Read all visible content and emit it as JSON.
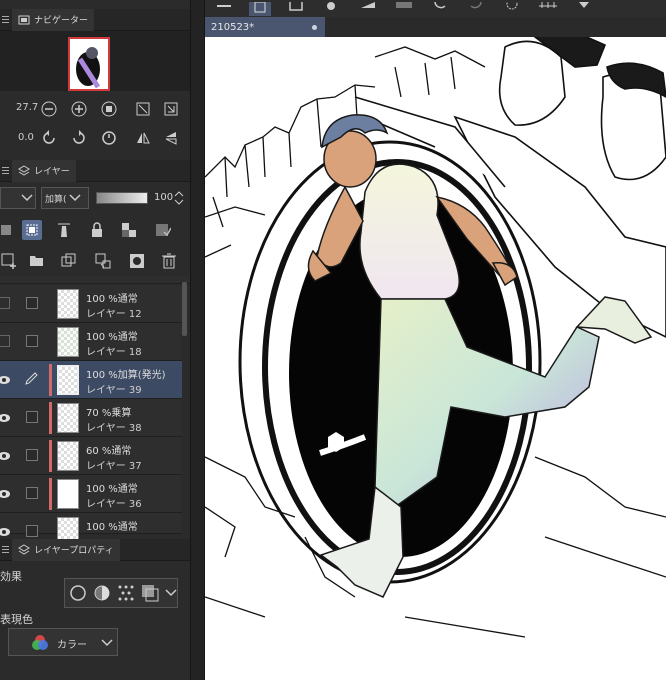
{
  "navigator": {
    "tab_label": "ナビゲーター",
    "zoom_value": "27.7",
    "rotation_value": "0.0"
  },
  "layer_panel": {
    "tab_label": "レイヤー",
    "blend_mode": "加算(",
    "opacity_value": "100",
    "layers": [
      {
        "blend": "100 %通常",
        "name": "レイヤー 12",
        "visible": false,
        "selected": false,
        "has_color_bar": false
      },
      {
        "blend": "100 %通常",
        "name": "レイヤー 18",
        "visible": false,
        "selected": false,
        "has_color_bar": false
      },
      {
        "blend": "100 %加算(発光)",
        "name": "レイヤー 39",
        "visible": true,
        "selected": true,
        "has_color_bar": true
      },
      {
        "blend": "70 %乗算",
        "name": "レイヤー 38",
        "visible": true,
        "selected": false,
        "has_color_bar": true
      },
      {
        "blend": "60 %通常",
        "name": "レイヤー 37",
        "visible": true,
        "selected": false,
        "has_color_bar": true
      },
      {
        "blend": "100 %通常",
        "name": "レイヤー 36",
        "visible": true,
        "selected": false,
        "has_color_bar": true
      },
      {
        "blend": "100 %通常",
        "name": "",
        "visible": true,
        "selected": false,
        "has_color_bar": false
      }
    ]
  },
  "layer_property": {
    "tab_label": "レイヤープロパティ",
    "effect_label": "効果",
    "expression_label": "表現色",
    "color_mode": "カラー"
  },
  "document": {
    "tab_title": "210523*"
  },
  "colors": {
    "selected_layer": "#3d4a63",
    "layer_color_bar": "#d06a6a",
    "canvas_bg": "#ffffff"
  }
}
